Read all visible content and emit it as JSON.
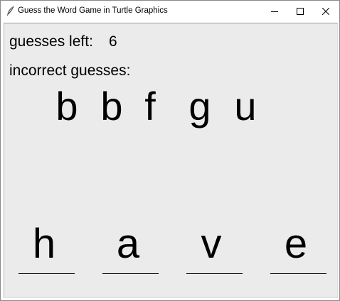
{
  "window": {
    "title": "Guess the Word Game in Turtle Graphics",
    "controls": {
      "minimize_icon": "minimize-icon",
      "maximize_icon": "maximize-icon",
      "close_icon": "close-icon"
    }
  },
  "game": {
    "guesses_left_label": "guesses left:",
    "guesses_left_value": "6",
    "incorrect_label": "incorrect guesses:",
    "incorrect_letters": [
      "b",
      "b",
      "f",
      "g",
      "u"
    ],
    "word_letters": [
      "h",
      "a",
      "v",
      "e"
    ]
  },
  "colors": {
    "canvas_background": "#ebebeb",
    "text": "#000000",
    "titlebar": "#ffffff"
  }
}
